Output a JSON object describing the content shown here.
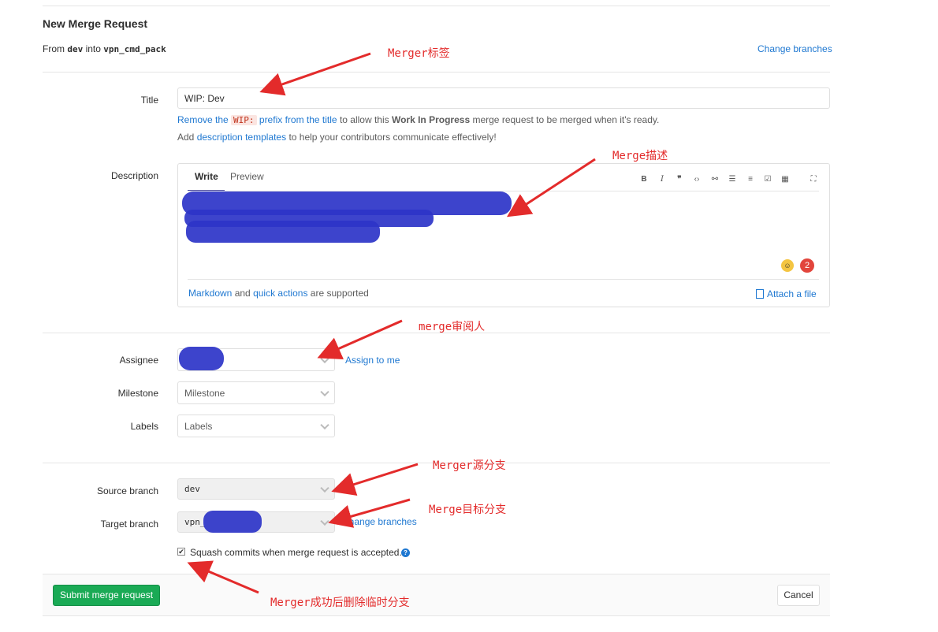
{
  "page": {
    "title": "New Merge Request",
    "from_prefix": "From",
    "source": "dev",
    "into": "into",
    "target": "vpn_cmd_pack",
    "change_branches": "Change branches"
  },
  "title_field": {
    "label": "Title",
    "value": "WIP: Dev",
    "hint_remove": "Remove the",
    "hint_wip": "WIP:",
    "hint_prefix_link": "prefix from the title",
    "hint_rest1": "to allow this",
    "hint_bold": "Work In Progress",
    "hint_rest2": "merge request to be merged when it's ready.",
    "templates_pre": "Add",
    "templates_link": "description templates",
    "templates_post": "to help your contributors communicate effectively!"
  },
  "description": {
    "label": "Description",
    "tab_write": "Write",
    "tab_preview": "Preview",
    "markdown_link": "Markdown",
    "and": "and",
    "quick_actions": "quick actions",
    "supported": "are supported",
    "attach": "Attach a file",
    "badge_count": "2",
    "toolbar_icons": [
      "bold-icon",
      "italic-icon",
      "quote-icon",
      "code-icon",
      "link-icon",
      "bullet-list-icon",
      "numbered-list-icon",
      "task-list-icon",
      "table-icon",
      "fullscreen-icon"
    ]
  },
  "assignee": {
    "label": "Assignee",
    "assign_to_me": "Assign to me"
  },
  "milestone": {
    "label": "Milestone",
    "value": "Milestone"
  },
  "labels": {
    "label": "Labels",
    "value": "Labels"
  },
  "source_branch": {
    "label": "Source branch",
    "value": "dev"
  },
  "target_branch": {
    "label": "Target branch",
    "value": "vpn_",
    "change_branches": "Change branches"
  },
  "squash": {
    "label": "Squash commits when merge request is accepted.",
    "checked": true
  },
  "footer": {
    "submit": "Submit merge request",
    "cancel": "Cancel"
  },
  "annotations": {
    "title_note": "Merger标签",
    "desc_note": "Merge描述",
    "assignee_note": "merge审阅人",
    "source_note": "Merger源分支",
    "target_note": "Merge目标分支",
    "squash_note": "Merger成功后删除临时分支"
  },
  "colors": {
    "link": "#1f78d1",
    "submit": "#1aaa55",
    "annotation": "#e32b2b",
    "redaction": "#2d34c8"
  }
}
